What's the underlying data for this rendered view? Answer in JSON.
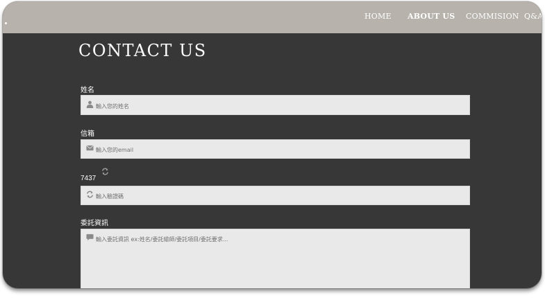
{
  "nav": {
    "items": [
      {
        "label": "HOME",
        "active": false
      },
      {
        "label": "ABOUT US",
        "active": true
      },
      {
        "label": "COMMISION",
        "active": false
      },
      {
        "label": "Q&A",
        "active": false
      }
    ]
  },
  "page": {
    "title": "CONTACT US"
  },
  "form": {
    "name": {
      "label": "姓名",
      "placeholder": "輸入您的姓名",
      "value": "",
      "icon": "user-icon"
    },
    "email": {
      "label": "信箱",
      "placeholder": "輸入您的email",
      "value": "",
      "icon": "envelope-icon"
    },
    "captcha": {
      "code": "7437",
      "placeholder": "輸入驗證碼",
      "value": "",
      "icon": "refresh-icon"
    },
    "message": {
      "label": "委託資訊",
      "placeholder": "輸入委託資訊 ex:姓名/委託繪師/委託項目/委託要求...",
      "value": "",
      "icon": "comment-icon"
    }
  },
  "colors": {
    "navbar": "#b7b2ab",
    "background": "#373737",
    "input": "#e9e9e9",
    "text": "#ffffff",
    "icon": "#8a8a8a"
  }
}
